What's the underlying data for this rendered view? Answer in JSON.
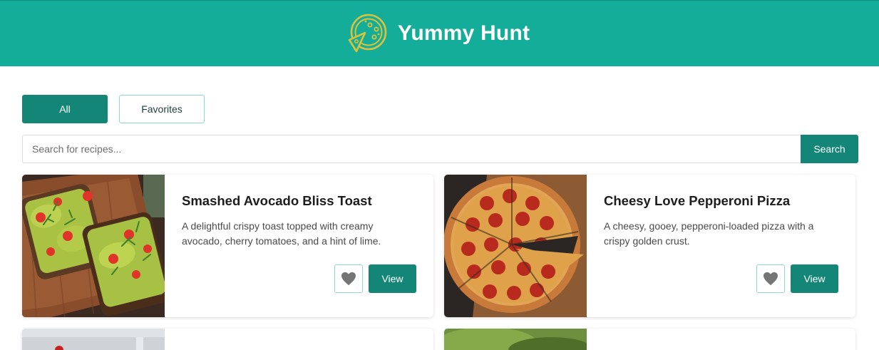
{
  "header": {
    "title": "Yummy Hunt",
    "logo_icon": "pizza-icon",
    "background": "#14ad9a"
  },
  "filters": {
    "all_label": "All",
    "favorites_label": "Favorites",
    "active": "All"
  },
  "search": {
    "placeholder": "Search for recipes...",
    "value": "",
    "button_label": "Search"
  },
  "colors": {
    "accent": "#138678",
    "accent_border": "#8ed8cf"
  },
  "recipes": [
    {
      "title": "Smashed Avocado Bliss Toast",
      "description": "A delightful crispy toast topped with creamy avocado, cherry tomatoes, and a hint of lime.",
      "favorite_icon": "heart-icon",
      "view_label": "View"
    },
    {
      "title": "Cheesy Love Pepperoni Pizza",
      "description": "A cheesy, gooey, pepperoni-loaded pizza with a crispy golden crust.",
      "favorite_icon": "heart-icon",
      "view_label": "View"
    }
  ]
}
